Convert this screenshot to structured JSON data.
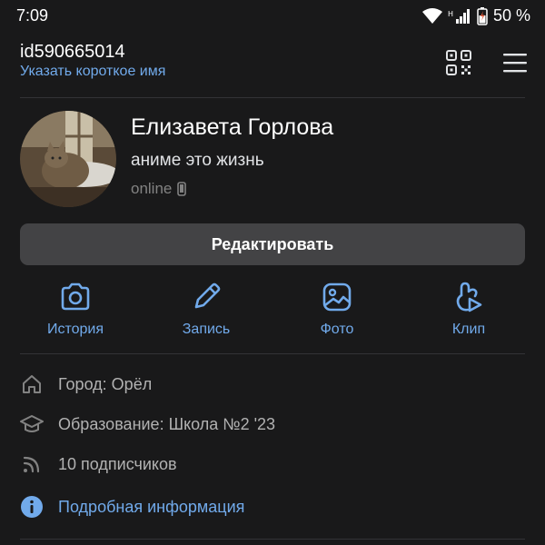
{
  "status_bar": {
    "time": "7:09",
    "battery": "50 %"
  },
  "header": {
    "user_id": "id590665014",
    "short_name_link": "Указать короткое имя"
  },
  "profile": {
    "name": "Елизавета Горлова",
    "status": "аниме это жизнь",
    "online": "online"
  },
  "edit_button": "Редактировать",
  "actions": [
    {
      "label": "История",
      "icon": "camera-icon"
    },
    {
      "label": "Запись",
      "icon": "pencil-icon"
    },
    {
      "label": "Фото",
      "icon": "image-icon"
    },
    {
      "label": "Клип",
      "icon": "clip-icon"
    }
  ],
  "info": {
    "city": "Город: Орёл",
    "education": "Образование: Школа №2 '23",
    "followers": "10 подписчиков",
    "more": "Подробная информация"
  },
  "colors": {
    "background": "#19191a",
    "accent": "#71aaeb",
    "button": "#434345",
    "muted": "#828282"
  }
}
